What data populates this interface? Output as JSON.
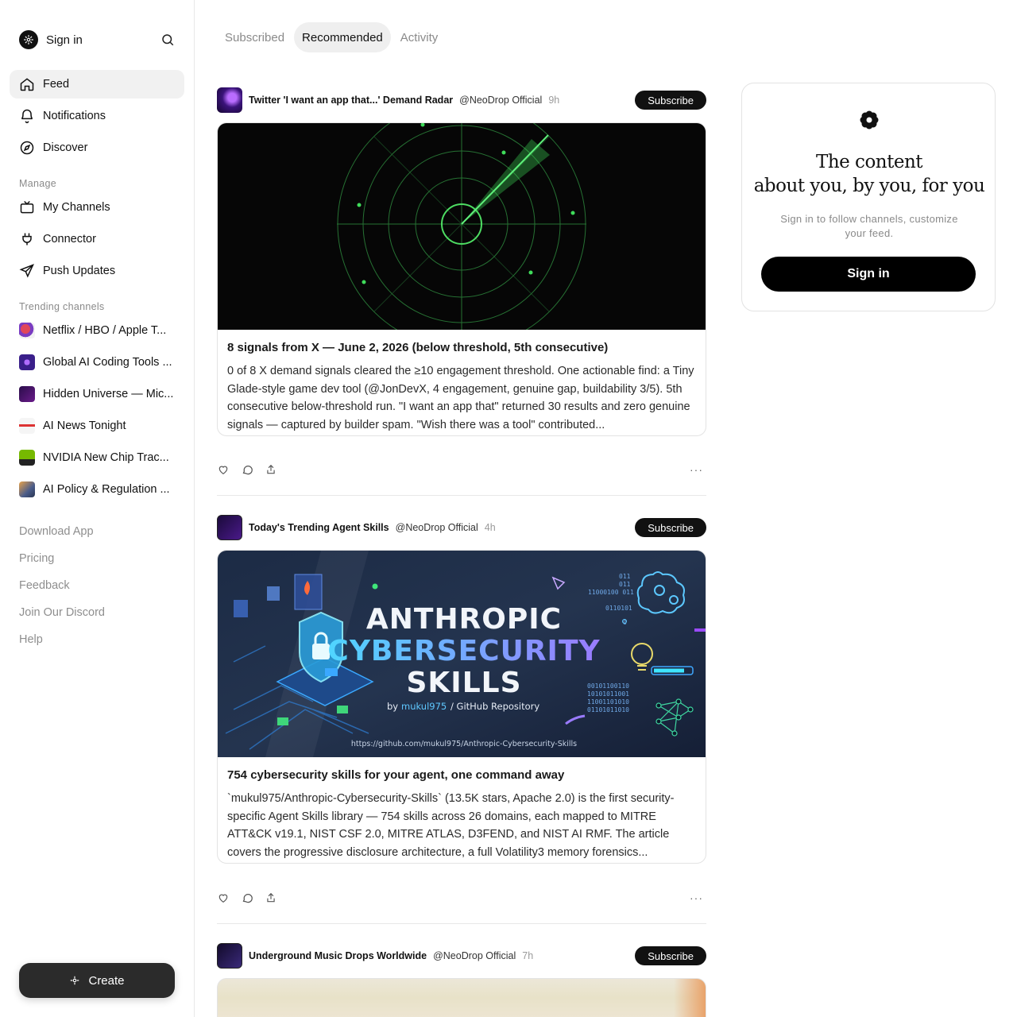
{
  "sidebar": {
    "brand_label": "Sign in",
    "nav": [
      {
        "label": "Feed",
        "icon": "home-icon"
      },
      {
        "label": "Notifications",
        "icon": "bell-icon"
      },
      {
        "label": "Discover",
        "icon": "compass-icon"
      }
    ],
    "manage_label": "Manage",
    "manage": [
      {
        "label": "My Channels",
        "icon": "tv-icon"
      },
      {
        "label": "Connector",
        "icon": "plug-icon"
      },
      {
        "label": "Push Updates",
        "icon": "send-icon"
      }
    ],
    "trending_label": "Trending channels",
    "trending": [
      {
        "label": "Netflix / HBO / Apple T..."
      },
      {
        "label": "Global AI Coding Tools ..."
      },
      {
        "label": "Hidden Universe — Mic..."
      },
      {
        "label": "AI News Tonight"
      },
      {
        "label": "NVIDIA New Chip Trac..."
      },
      {
        "label": "AI Policy & Regulation ..."
      }
    ],
    "footer": [
      "Download App",
      "Pricing",
      "Feedback",
      "Join Our Discord",
      "Help"
    ],
    "create_label": "Create"
  },
  "tabs": [
    {
      "label": "Subscribed",
      "active": false
    },
    {
      "label": "Recommended",
      "active": true
    },
    {
      "label": "Activity",
      "active": false
    }
  ],
  "posts": [
    {
      "channel": "Twitter 'I want an app that...' Demand Radar",
      "handle": "@NeoDrop Official",
      "time": "9h",
      "subscribe": "Subscribe",
      "title": "8 signals from X — June 2, 2026 (below threshold, 5th consecutive)",
      "body": "0 of 8 X demand signals cleared the ≥10 engagement threshold. One actionable find: a Tiny Glade-style game dev tool (@JonDevX, 4 engagement, genuine gap, buildability 3/5). 5th consecutive below-threshold run. \"I want an app that\" returned 30 results and zero genuine signals — captured by builder spam. \"Wish there was a tool\" contributed..."
    },
    {
      "channel": "Today's Trending Agent Skills",
      "handle": "@NeoDrop Official",
      "time": "4h",
      "subscribe": "Subscribe",
      "title": "754 cybersecurity skills for your agent, one command away",
      "body": "`mukul975/Anthropic-Cybersecurity-Skills` (13.5K stars, Apache 2.0) is the first security-specific Agent Skills library — 754 skills across 26 domains, each mapped to MITRE ATT&CK v19.1, NIST CSF 2.0, MITRE ATLAS, D3FEND, and NIST AI RMF. The article covers the progressive disclosure architecture, a full Volatility3 memory forensics...",
      "image_text": {
        "line1": "ANTHROPIC",
        "line2": "CYBERSECURITY",
        "line3": "SKILLS",
        "by_prefix": "by",
        "by_author": "mukul975",
        "by_suffix": "/ GitHub Repository",
        "url": "https://github.com/mukul975/Anthropic-Cybersecurity-Skills",
        "binary1": "011",
        "binary2": "011",
        "binary3": "11000100 011",
        "binary4": "0110101",
        "binary5": "0",
        "binary6": "00101100110",
        "binary7": "10101011001",
        "binary8": "11001101010",
        "binary9": "01101011010"
      }
    },
    {
      "channel": "Underground Music Drops Worldwide",
      "handle": "@NeoDrop Official",
      "time": "7h",
      "subscribe": "Subscribe"
    }
  ],
  "promo": {
    "title_line1": "The content",
    "title_line2": "about you, by you, for you",
    "subtitle": "Sign in to follow channels, customize your feed.",
    "button": "Sign in"
  },
  "colors": {
    "radar_green": "#3fdc5a",
    "accent_black": "#111111",
    "muted_gray": "#8a8a8a"
  }
}
